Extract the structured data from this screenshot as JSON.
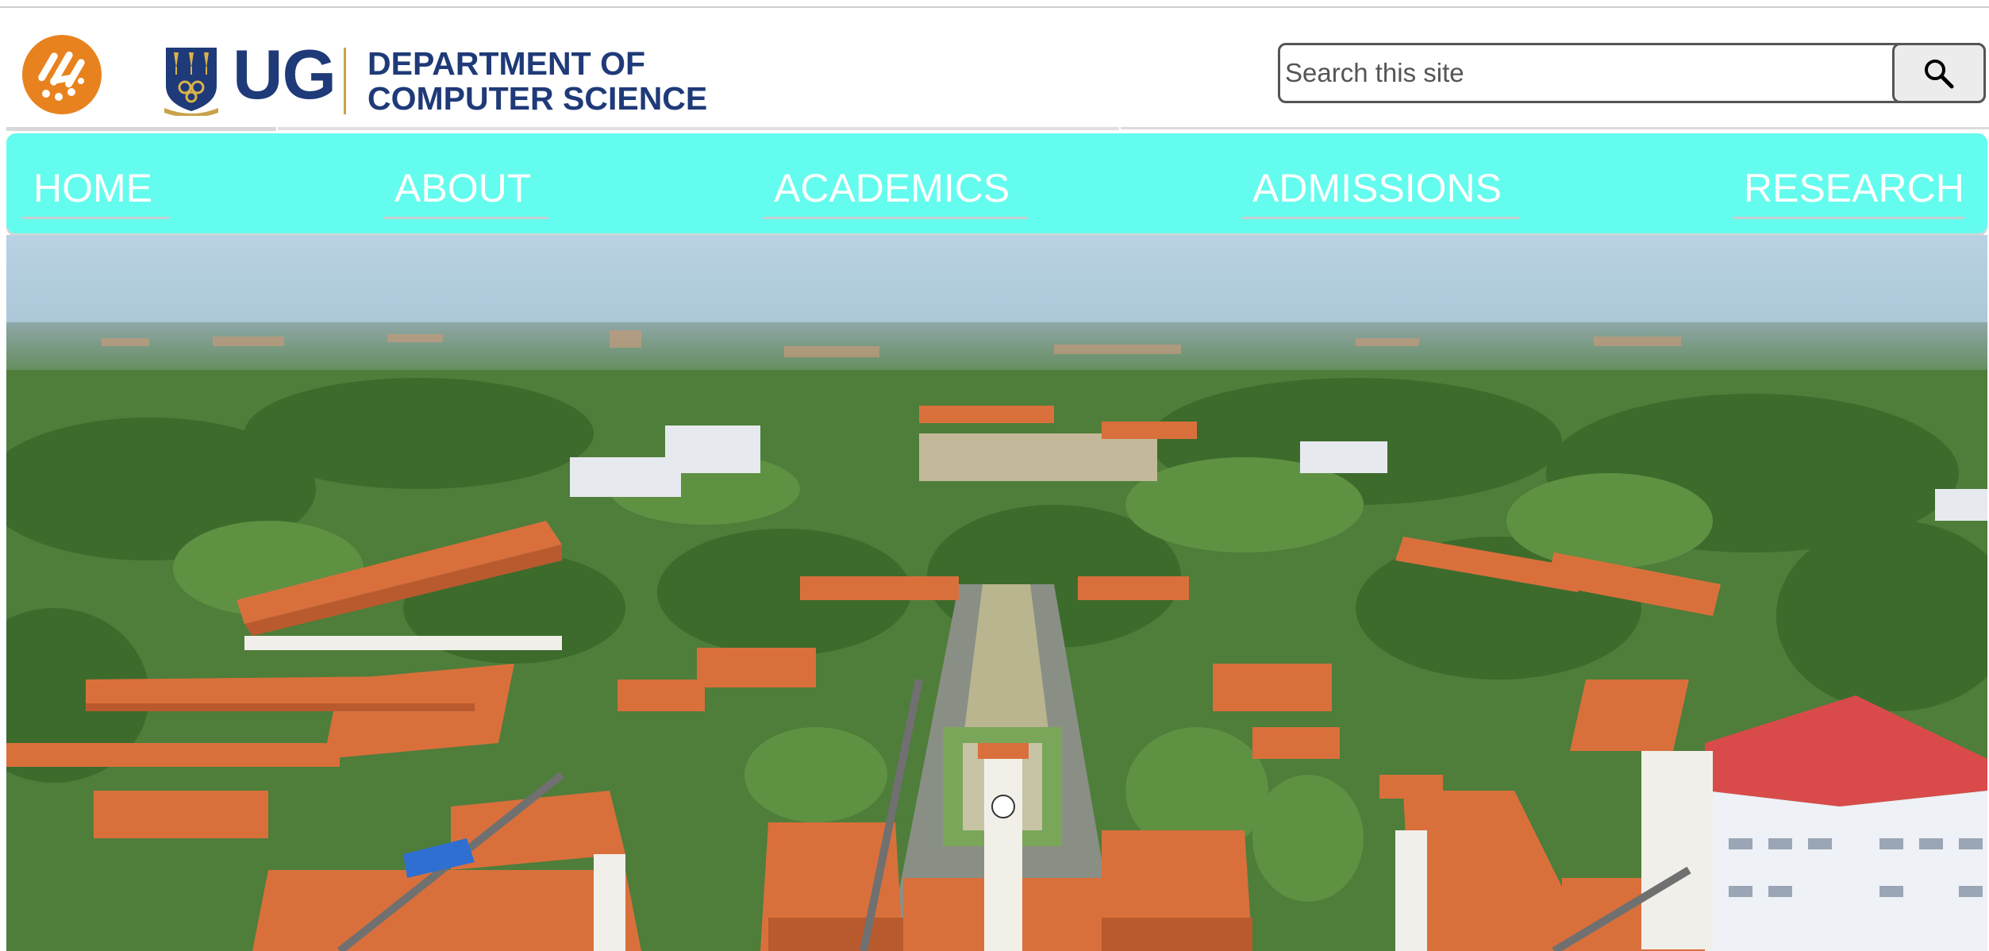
{
  "header": {
    "site_logo_icon": "orange-circle-logo-icon",
    "ug_logo": {
      "crest_icon": "university-crest-icon",
      "mark": "UG",
      "department_line_1": "DEPARTMENT OF",
      "department_line_2": "COMPUTER SCIENCE"
    }
  },
  "search": {
    "placeholder": "Search this site",
    "value": "",
    "button_icon": "search-icon"
  },
  "nav": {
    "items": [
      {
        "label": "HOME"
      },
      {
        "label": "ABOUT"
      },
      {
        "label": "ACADEMICS"
      },
      {
        "label": "ADMISSIONS"
      },
      {
        "label": "RESEARCH"
      }
    ]
  },
  "hero": {
    "image": "aerial-campus-photo"
  },
  "colors": {
    "nav_background": "#64fcee",
    "nav_text": "#ffffff",
    "brand_blue": "#1f3a78",
    "logo_orange": "#e8821e",
    "roof_terracotta": "#d9703c"
  }
}
